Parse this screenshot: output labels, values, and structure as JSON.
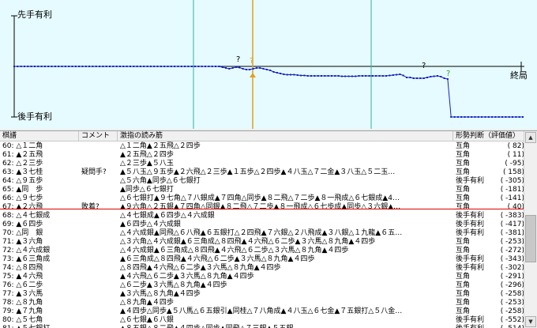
{
  "graph": {
    "top_label": "先手有利",
    "bottom_label": "後手有利",
    "end_label": "終局",
    "question_marks": [
      "?",
      "?",
      "?"
    ],
    "highlight_mark": "?",
    "values": [
      0,
      0,
      0,
      0,
      0,
      0,
      0,
      0,
      0,
      0,
      0,
      0,
      0,
      0,
      0,
      0,
      0,
      0,
      0,
      0,
      0,
      0,
      0,
      0,
      0,
      0,
      0,
      0,
      0,
      0,
      0,
      0,
      0,
      0,
      0,
      0,
      0,
      0,
      0,
      0,
      0,
      0,
      0,
      0,
      0,
      0,
      0,
      0,
      0,
      0,
      0,
      0,
      0,
      0,
      0,
      0,
      0,
      0,
      0,
      0,
      0,
      -20,
      -40,
      -60,
      -40,
      -20,
      -30,
      -60,
      -80,
      -80,
      -60,
      -40,
      -40,
      -60,
      -80,
      -100,
      -140,
      -160,
      -180,
      -200,
      -210,
      -210,
      -210,
      -220,
      -230,
      -230,
      -240,
      -240,
      -240,
      -240,
      -240,
      -240,
      -240,
      -240,
      -240,
      -240,
      -250,
      -250,
      -250,
      -250,
      -250,
      -240,
      -240,
      -240,
      -240,
      -240,
      -240,
      -240,
      -240,
      -240,
      -230,
      -220,
      -210,
      -200,
      -230,
      -280,
      -280,
      -300,
      -300,
      -300,
      -300,
      -280,
      -260,
      -250,
      -240,
      -260,
      -300,
      -320,
      -2000,
      -2000,
      -2000,
      -2000,
      -2000,
      -2000,
      -2000,
      -2000,
      -2000,
      -2000,
      -2000,
      -2000,
      -2000,
      -2000,
      -2000,
      -2000,
      -2000,
      -2000,
      -2000,
      -2000,
      -2000,
      -2000
    ]
  },
  "table": {
    "headers": [
      "棋譜",
      "コメント",
      "激指の読み筋",
      "形勢判断（評価値）"
    ],
    "rows": [
      {
        "move": "60: △１二角",
        "comment": "",
        "reading": "△１二角▲２五飛△２四歩",
        "judge": "互角",
        "value": "(      82)"
      },
      {
        "move": "61: ▲２五飛",
        "comment": "",
        "reading": "▲２五飛△２四歩",
        "judge": "互角",
        "value": "(      11)"
      },
      {
        "move": "62: △２三歩",
        "comment": "",
        "reading": "△２三歩▲５八玉",
        "judge": "互角",
        "value": "(     -95)"
      },
      {
        "move": "63: ▲３七桂",
        "comment": "疑問手?",
        "reading": "▲５八玉△９五歩▲２六飛△２三歩▲１五歩△２四歩▲４八玉△７二金▲３八玉△５二玉…",
        "judge": "互角",
        "value": "(     158)"
      },
      {
        "move": "64: △９五歩",
        "comment": "",
        "reading": "△５六角▲同歩△６七銀打",
        "judge": "後手有利",
        "value": "(    -305)"
      },
      {
        "move": "65: ▲同　歩",
        "comment": "",
        "reading": "▲同歩△６七銀打",
        "judge": "互角",
        "value": "(    -181)"
      },
      {
        "move": "66: △９七歩",
        "comment": "",
        "reading": "△６七銀打▲９七角△７八銀成▲７四角△同歩▲８二飛△７二歩▲８一飛成△６七銀成▲4…",
        "judge": "互角",
        "value": "(    -141)"
      },
      {
        "move": "67: ▲２六飛",
        "comment": "敗着?",
        "reading": "▲９六角△２五銀▲７四角△同銀▲８二飛△７二歩▲８一飛成△６七歩成▲同歩△３六銀▲…",
        "judge": "互角",
        "value": "(      40)"
      },
      {
        "move": "68: △４七銀成",
        "comment": "",
        "reading": "△４七銀成▲６四歩△４六成銀",
        "judge": "後手有利",
        "value": "(    -383)"
      },
      {
        "move": "69: ▲６四歩",
        "comment": "",
        "reading": "▲６四歩△４六成銀",
        "judge": "後手有利",
        "value": "(    -417)"
      },
      {
        "move": "70: △同　銀",
        "comment": "",
        "reading": "△４六成銀▲同飛△６八飛▲６五銀打△２四飛▲７六銀△２八飛成▲３八銀△１九龍▲６五…",
        "judge": "後手有利",
        "value": "(    -381)"
      },
      {
        "move": "71: ▲３六角",
        "comment": "",
        "reading": "△３六角△４六成銀▲６三角成△８四飛▲４六飛△６二歩▲３六馬△８九角▲４四歩",
        "judge": "互角",
        "value": "(    -253)"
      },
      {
        "move": "72: △４六成銀",
        "comment": "",
        "reading": "△４六成銀▲６三角成△８四飛▲４六飛△６二歩△３六馬△８九角▲４四歩",
        "judge": "互角",
        "value": "(    -272)"
      },
      {
        "move": "73: ▲６三角成",
        "comment": "",
        "reading": "▲６三角成△８四飛▲４六飛△６二歩▲３六馬△８九角▲４四歩",
        "judge": "後手有利",
        "value": "(    -343)"
      },
      {
        "move": "74: △８四飛",
        "comment": "",
        "reading": "△８四飛▲４六飛△６二歩▲３六馬△８九角▲４四歩",
        "judge": "後手有利",
        "value": "(    -302)"
      },
      {
        "move": "75: ▲４六飛",
        "comment": "",
        "reading": "▲４六飛△６二歩▲３六馬△８九角▲４四歩",
        "judge": "互角",
        "value": "(    -291)"
      },
      {
        "move": "76: △６二歩",
        "comment": "",
        "reading": "△６二歩▲３六馬△８九角▲４四歩",
        "judge": "互角",
        "value": "(    -296)"
      },
      {
        "move": "77: ▲３六馬",
        "comment": "",
        "reading": "▲３六馬△８九角▲４四歩",
        "judge": "互角",
        "value": "(    -258)"
      },
      {
        "move": "78: △８九角",
        "comment": "",
        "reading": "△８九角▲４四歩",
        "judge": "互角",
        "value": "(    -253)"
      },
      {
        "move": "79: ▲７九角",
        "comment": "",
        "reading": "▲４四歩△同歩▲５八馬△６五銀引▲同桂△７八角成▲４八玉△６七金▲７五銀打△５八金…",
        "judge": "互角",
        "value": "(    -258)"
      },
      {
        "move": "80: △５七角",
        "comment": "",
        "reading": "△６七銀▲６八銀",
        "judge": "後手有利",
        "value": "(    -552)"
      },
      {
        "move": "81: ▲５七銀打",
        "comment": "",
        "reading": "▲８五銀△８二飛▲４四歩△同歩▲同飛△７三銀▲５五銀",
        "judge": "後手有利",
        "value": "(    -514)"
      }
    ]
  },
  "scrollbar": {
    "up": "▲",
    "down": "▼"
  }
}
